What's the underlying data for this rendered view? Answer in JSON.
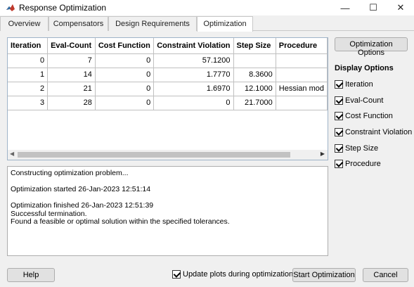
{
  "window": {
    "title": "Response Optimization",
    "minimize_glyph": "—",
    "maximize_glyph": "☐",
    "close_glyph": "✕",
    "icon": "matlab-icon"
  },
  "tabs": [
    {
      "label": "Overview",
      "active": false
    },
    {
      "label": "Compensators",
      "active": false
    },
    {
      "label": "Design Requirements",
      "active": false
    },
    {
      "label": "Optimization",
      "active": true
    }
  ],
  "table": {
    "columns": [
      "Iteration",
      "Eval-Count",
      "Cost Function",
      "Constraint Violation",
      "Step Size",
      "Procedure"
    ],
    "rows": [
      [
        "0",
        "7",
        "0",
        "57.1200",
        "",
        ""
      ],
      [
        "1",
        "14",
        "0",
        "1.7770",
        "8.3600",
        ""
      ],
      [
        "2",
        "21",
        "0",
        "1.6970",
        "12.1000",
        "Hessian mod"
      ],
      [
        "3",
        "28",
        "0",
        "0",
        "21.7000",
        ""
      ]
    ]
  },
  "log": {
    "line1": "Constructing optimization problem...",
    "line2": "Optimization started 26-Jan-2023 12:51:14",
    "line3": "Optimization finished 26-Jan-2023 12:51:39",
    "line4": "Successful termination.",
    "line5": "Found a feasible or optimal solution within the specified tolerances."
  },
  "right_panel": {
    "options_button": "Optimization Options",
    "display_heading": "Display Options",
    "checkboxes": [
      {
        "label": "Iteration",
        "checked": true
      },
      {
        "label": "Eval-Count",
        "checked": true
      },
      {
        "label": "Cost Function",
        "checked": true
      },
      {
        "label": "Constraint Violation",
        "checked": true
      },
      {
        "label": "Step Size",
        "checked": true
      },
      {
        "label": "Procedure",
        "checked": true
      }
    ]
  },
  "footer": {
    "help": "Help",
    "update_plots": "Update plots during optimization",
    "update_plots_checked": true,
    "start": "Start Optimization",
    "cancel": "Cancel"
  },
  "colors": {
    "window_bg": "#f0f0f0",
    "table_border": "#9fb3c8"
  }
}
